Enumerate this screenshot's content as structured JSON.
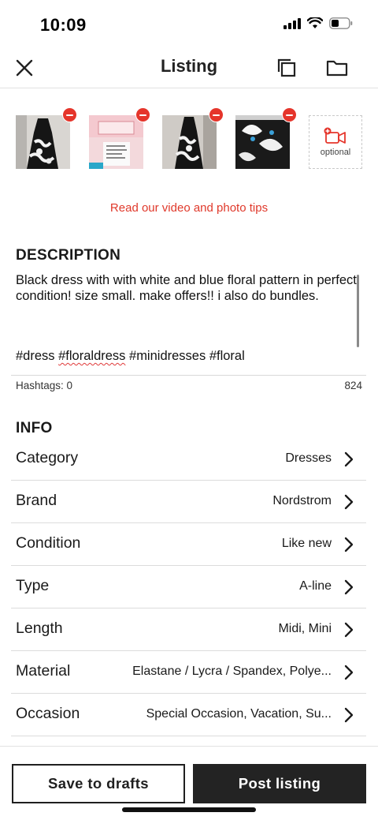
{
  "status_bar": {
    "time": "10:09"
  },
  "header": {
    "title": "Listing"
  },
  "photos": {
    "items": [
      "photo-1",
      "photo-2",
      "photo-3",
      "photo-4"
    ],
    "video_optional_label": "optional"
  },
  "tips_link": "Read our video and photo tips",
  "description": {
    "title": "DESCRIPTION",
    "text": "Black dress with with white and blue floral pattern in perfect condition! size small. make offers!! i also do bundles.",
    "hashtags": {
      "tag1": "#dress",
      "tag2": "#floraldress",
      "tag3": "#minidresses",
      "tag4": "#floral"
    },
    "hashtag_count": "Hashtags: 0",
    "char_count": "824"
  },
  "info": {
    "title": "INFO",
    "rows": [
      {
        "label": "Category",
        "value": "Dresses"
      },
      {
        "label": "Brand",
        "value": "Nordstrom"
      },
      {
        "label": "Condition",
        "value": "Like new"
      },
      {
        "label": "Type",
        "value": "A-line"
      },
      {
        "label": "Length",
        "value": "Midi, Mini"
      },
      {
        "label": "Material",
        "value": "Elastane / Lycra / Spandex, Polye..."
      },
      {
        "label": "Occasion",
        "value": "Special Occasion, Vacation, Su..."
      }
    ]
  },
  "actions": {
    "save_drafts": "Save to drafts",
    "post": "Post listing"
  },
  "colors": {
    "accent_red": "#e0392b",
    "dark": "#232323"
  }
}
